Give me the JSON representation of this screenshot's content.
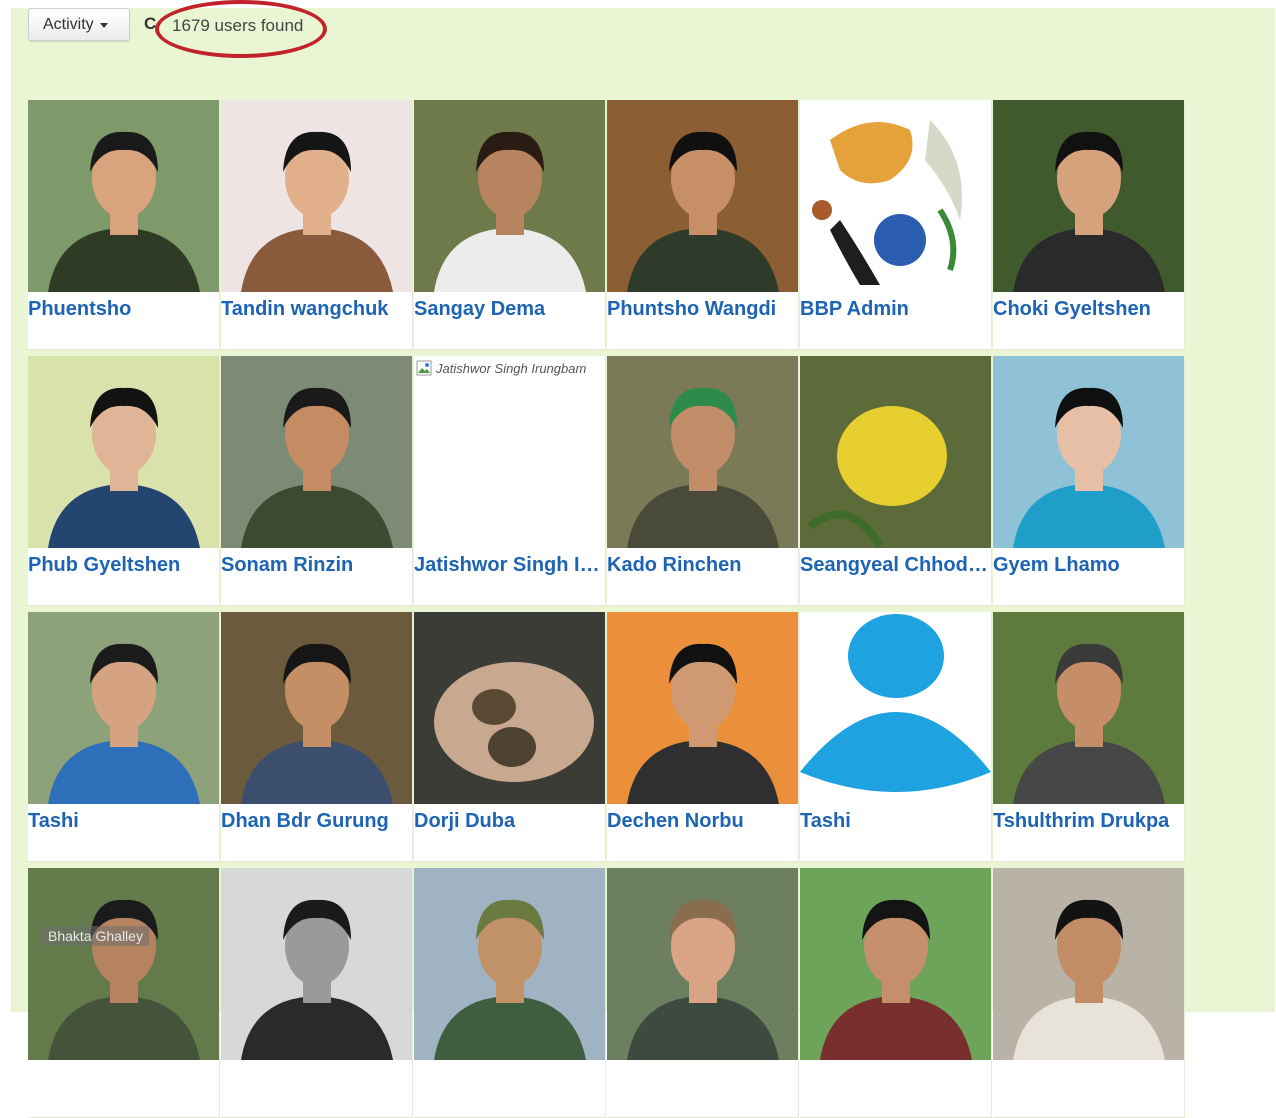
{
  "toolbar": {
    "activity_label": "Activity",
    "clipped_glyph": "C",
    "results_count": "1679 users found",
    "annotation_color": "#c2232a"
  },
  "users": [
    {
      "name": "Phuentsho",
      "photo": "person-photo",
      "colors": {
        "bg": "#7f9a6a",
        "skin": "#d9a37d",
        "hair": "#1a1a1a",
        "shirt": "#2f3b25"
      }
    },
    {
      "name": "Tandin wangchuk",
      "photo": "person-photo",
      "colors": {
        "bg": "#efe4e4",
        "skin": "#e1b08a",
        "hair": "#151515",
        "shirt": "#8a5a3c"
      }
    },
    {
      "name": "Sangay Dema",
      "photo": "person-photo",
      "colors": {
        "bg": "#6f7a4a",
        "skin": "#b8835f",
        "hair": "#2a1c14",
        "shirt": "#ececec"
      }
    },
    {
      "name": "Phuntsho Wangdi",
      "photo": "person-photo",
      "colors": {
        "bg": "#8c5e33",
        "skin": "#c78f66",
        "hair": "#101010",
        "shirt": "#2e3b2b"
      }
    },
    {
      "name": "BBP Admin",
      "photo": "logo-image",
      "colors": {
        "bg": "#ffffff"
      }
    },
    {
      "name": "Choki Gyeltshen",
      "photo": "person-photo",
      "colors": {
        "bg": "#3f5a2c",
        "skin": "#d5a27b",
        "hair": "#111111",
        "shirt": "#2a2a2a"
      }
    },
    {
      "name": "Phub Gyeltshen",
      "photo": "person-photo",
      "colors": {
        "bg": "#d9e2ab",
        "skin": "#e0b497",
        "hair": "#121212",
        "shirt": "#23456f"
      }
    },
    {
      "name": "Sonam Rinzin",
      "photo": "person-photo",
      "colors": {
        "bg": "#7c8a76",
        "skin": "#c58b62",
        "hair": "#1a1a1a",
        "shirt": "#3c4a2f"
      }
    },
    {
      "name": "Jatishwor Singh Irungbam",
      "photo": "broken-image",
      "alt": "Jatishwor Singh Irungbam",
      "colors": {
        "bg": "#ffffff"
      }
    },
    {
      "name": "Kado Rinchen",
      "photo": "person-photo",
      "colors": {
        "bg": "#7b7a56",
        "skin": "#c28e6a",
        "hair": "#2c8a4a",
        "shirt": "#4a4a3a"
      }
    },
    {
      "name": "Seangyeal Chhoden",
      "photo": "fruit-photo",
      "colors": {
        "bg": "#5d6b3a"
      }
    },
    {
      "name": "Gyem Lhamo",
      "photo": "person-photo",
      "colors": {
        "bg": "#8fc2d6",
        "skin": "#e7bfa6",
        "hair": "#0f0f0f",
        "shirt": "#1f9ec9"
      }
    },
    {
      "name": "Tashi",
      "photo": "person-photo",
      "colors": {
        "bg": "#8da17a",
        "skin": "#d6a382",
        "hair": "#1b1b1b",
        "shirt": "#2d6fb8"
      }
    },
    {
      "name": "Dhan Bdr Gurung",
      "photo": "person-photo",
      "colors": {
        "bg": "#6b5b3c",
        "skin": "#c48f64",
        "hair": "#161616",
        "shirt": "#3c4e6d"
      }
    },
    {
      "name": "Dorji Duba",
      "photo": "hands-photo",
      "colors": {
        "bg": "#3c3c36"
      }
    },
    {
      "name": "Dechen Norbu",
      "photo": "person-photo",
      "colors": {
        "bg": "#ec8f3a",
        "skin": "#cf9a72",
        "hair": "#111111",
        "shirt": "#2f2f2f"
      }
    },
    {
      "name": "Tashi",
      "photo": "default-avatar",
      "colors": {
        "bg": "#ffffff"
      }
    },
    {
      "name": "Tshulthrim Drukpa",
      "photo": "person-photo",
      "colors": {
        "bg": "#5d7b3d",
        "skin": "#c58e68",
        "hair": "#3a3a3a",
        "shirt": "#474747"
      }
    },
    {
      "name": "",
      "photo": "person-photo",
      "watermark": "Bhakta Ghalley",
      "colors": {
        "bg": "#637a4a",
        "skin": "#b5835f",
        "hair": "#1b1b1b",
        "shirt": "#45533b"
      }
    },
    {
      "name": "",
      "photo": "person-photo",
      "colors": {
        "bg": "#d8d8d8",
        "skin": "#9a9a9a",
        "hair": "#1a1a1a",
        "shirt": "#2a2a2a"
      }
    },
    {
      "name": "",
      "photo": "person-photo",
      "colors": {
        "bg": "#9fb3c3",
        "skin": "#c19168",
        "hair": "#6b7a40",
        "shirt": "#3f5d3f"
      }
    },
    {
      "name": "",
      "photo": "person-photo",
      "colors": {
        "bg": "#6c7f5e",
        "skin": "#d9a486",
        "hair": "#8a6d4d",
        "shirt": "#3d4a40"
      }
    },
    {
      "name": "",
      "photo": "person-photo",
      "colors": {
        "bg": "#6ea35a",
        "skin": "#c48f6a",
        "hair": "#141414",
        "shirt": "#7a2f2f"
      }
    },
    {
      "name": "",
      "photo": "person-photo",
      "colors": {
        "bg": "#b8b3a6",
        "skin": "#c18c66",
        "hair": "#131313",
        "shirt": "#e8e3d8"
      }
    }
  ]
}
